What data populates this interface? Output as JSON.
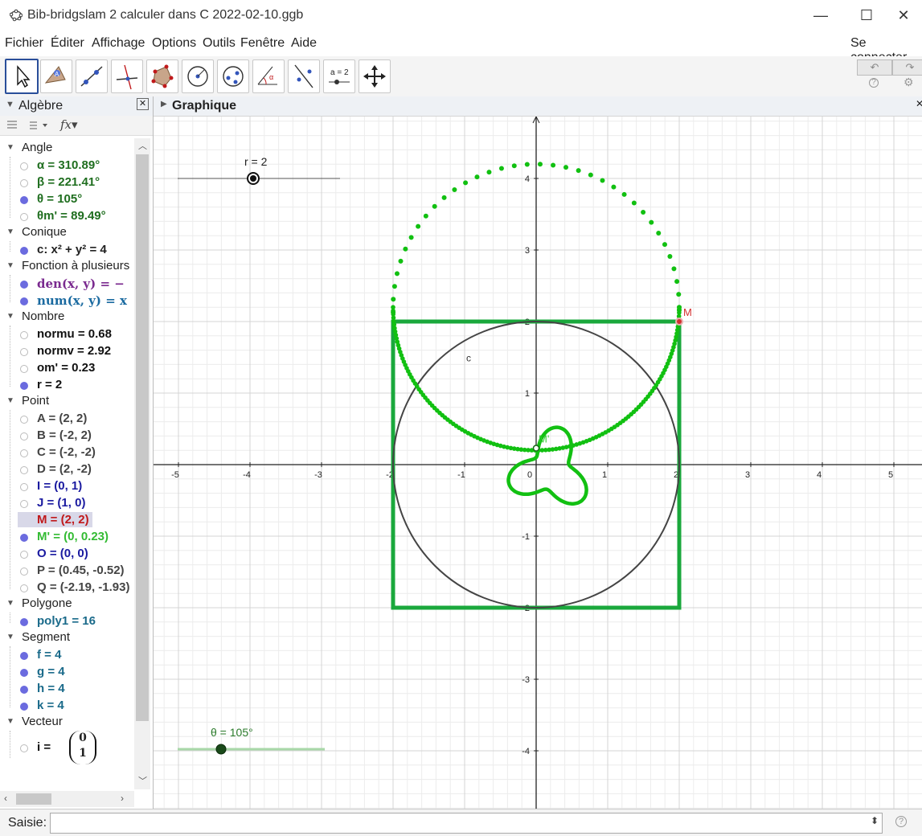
{
  "window": {
    "title": "Bib-bridgslam 2 calculer dans C 2022-02-10.ggb"
  },
  "menu": {
    "items": [
      "Fichier",
      "Éditer",
      "Affichage",
      "Options",
      "Outils",
      "Fenêtre",
      "Aide"
    ],
    "login": "Se connecter"
  },
  "toolbar": {
    "undo": "↶",
    "redo": "↷",
    "help": "?",
    "settings": "⚙",
    "slider_tool_label": "a = 2"
  },
  "algebra": {
    "title": "Algèbre",
    "categories": [
      {
        "name": "Angle",
        "items": [
          {
            "text": "α = 310.89°",
            "shown": false,
            "color": "#1f6e1f"
          },
          {
            "text": "β = 221.41°",
            "shown": false,
            "color": "#1f6e1f"
          },
          {
            "text": "θ = 105°",
            "shown": true,
            "color": "#1f6e1f"
          },
          {
            "text": "θm' = 89.49°",
            "shown": false,
            "color": "#1f6e1f"
          }
        ]
      },
      {
        "name": "Conique",
        "items": [
          {
            "text": "c: x² + y² = 4",
            "shown": true,
            "color": "#222222"
          }
        ]
      },
      {
        "name": "Fonction à plusieurs",
        "items": [
          {
            "text": "den(x, y) = −",
            "shown": true,
            "color": "#7a2a8f"
          },
          {
            "text": "num(x, y) = x",
            "shown": true,
            "color": "#1a6aa0"
          }
        ]
      },
      {
        "name": "Nombre",
        "items": [
          {
            "text": "normu = 0.68",
            "shown": false,
            "color": "#111111"
          },
          {
            "text": "normv = 2.92",
            "shown": false,
            "color": "#111111"
          },
          {
            "text": "om' = 0.23",
            "shown": false,
            "color": "#111111"
          },
          {
            "text": "r = 2",
            "shown": true,
            "color": "#111111"
          }
        ]
      },
      {
        "name": "Point",
        "items": [
          {
            "text": "A = (2, 2)",
            "shown": false,
            "color": "#444444"
          },
          {
            "text": "B = (-2, 2)",
            "shown": false,
            "color": "#444444"
          },
          {
            "text": "C = (-2, -2)",
            "shown": false,
            "color": "#444444"
          },
          {
            "text": "D = (2, -2)",
            "shown": false,
            "color": "#444444"
          },
          {
            "text": "I = (0, 1)",
            "shown": false,
            "color": "#1a1aa0"
          },
          {
            "text": "J = (1, 0)",
            "shown": false,
            "color": "#1a1aa0"
          },
          {
            "text": "M = (2, 2)",
            "shown": true,
            "color": "#c0191b"
          },
          {
            "text": "M' = (0, 0.23)",
            "shown": true,
            "color": "#33bb33"
          },
          {
            "text": "O = (0, 0)",
            "shown": false,
            "color": "#1a1aa0"
          },
          {
            "text": "P = (0.45, -0.52)",
            "shown": false,
            "color": "#444444"
          },
          {
            "text": "Q = (-2.19, -1.93)",
            "shown": false,
            "color": "#444444"
          }
        ]
      },
      {
        "name": "Polygone",
        "items": [
          {
            "text": "poly1 = 16",
            "shown": true,
            "color": "#1a6a8a"
          }
        ]
      },
      {
        "name": "Segment",
        "items": [
          {
            "text": "f = 4",
            "shown": true,
            "color": "#1a6a8a"
          },
          {
            "text": "g = 4",
            "shown": true,
            "color": "#1a6a8a"
          },
          {
            "text": "h = 4",
            "shown": true,
            "color": "#1a6a8a"
          },
          {
            "text": "k = 4",
            "shown": true,
            "color": "#1a6a8a"
          }
        ]
      },
      {
        "name": "Vecteur",
        "items": [
          {
            "text": "i =",
            "shown": false,
            "color": "#111111",
            "vector": [
              "0",
              "1"
            ]
          }
        ]
      }
    ]
  },
  "graphics": {
    "title": "Graphique",
    "slider_r": {
      "label": "r = 2"
    },
    "slider_theta": {
      "label": "θ = 105°"
    },
    "labels": {
      "circle": "c",
      "M": "M",
      "Mprime": "M'"
    },
    "x_ticks": [
      "-5",
      "-4",
      "-3",
      "-2",
      "-1",
      "0",
      "1",
      "2",
      "3",
      "4",
      "5"
    ],
    "y_ticks": [
      "4",
      "3",
      "2",
      "1",
      "-1",
      "-2",
      "-3",
      "-4"
    ],
    "colors": {
      "accent": "#1aa83c",
      "dots": "#11c011",
      "circle": "#444444",
      "point_M": "#d43030"
    }
  },
  "input": {
    "label": "Saisie:",
    "value": ""
  }
}
